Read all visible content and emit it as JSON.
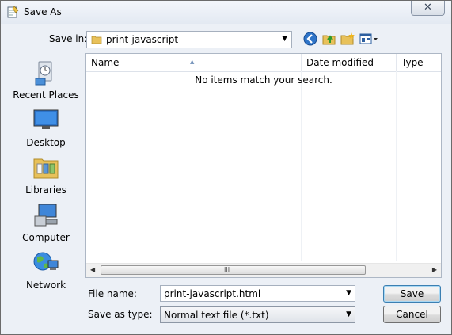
{
  "window": {
    "title": "Save As",
    "close_glyph": "✕"
  },
  "toolbar": {
    "save_in_label": "Save in:",
    "current_folder": "print-javascript",
    "icons": [
      "back-icon",
      "up-folder-icon",
      "new-folder-icon",
      "views-menu-icon"
    ]
  },
  "places": [
    {
      "label": "Recent Places",
      "icon": "recent-places-icon"
    },
    {
      "label": "Desktop",
      "icon": "desktop-icon"
    },
    {
      "label": "Libraries",
      "icon": "libraries-icon"
    },
    {
      "label": "Computer",
      "icon": "computer-icon"
    },
    {
      "label": "Network",
      "icon": "network-icon"
    }
  ],
  "file_list": {
    "columns": [
      "Name",
      "Date modified",
      "Type"
    ],
    "empty_message": "No items match your search.",
    "scroll_grip": "III"
  },
  "form": {
    "file_name_label": "File name:",
    "file_name_value": "print-javascript.html",
    "save_as_type_label": "Save as type:",
    "save_as_type_value": "Normal text file (*.txt)"
  },
  "buttons": {
    "save": "Save",
    "cancel": "Cancel"
  },
  "colors": {
    "accent": "#3c7fb1",
    "folder": "#e8c15a"
  }
}
